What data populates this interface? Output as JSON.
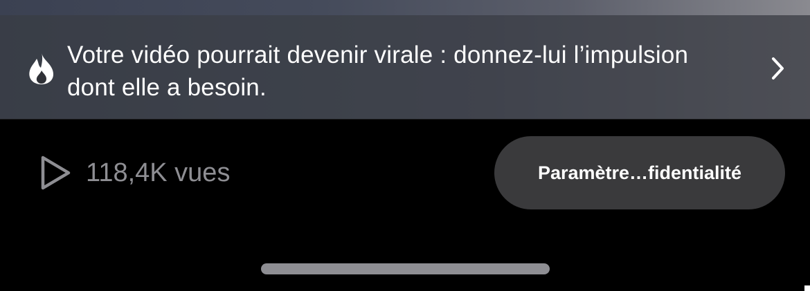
{
  "promo": {
    "text": "Votre vidéo pourrait devenir virale : donnez-lui l’impulsion dont elle a besoin.",
    "icon": "fire-icon",
    "action_icon": "chevron-right-icon"
  },
  "stats": {
    "views_label": "118,4K vues",
    "views_icon": "play-icon"
  },
  "privacy_button": {
    "label": "Paramètre…fidentialité"
  },
  "colors": {
    "background": "#000000",
    "banner_overlay": "#2f3137",
    "button_bg": "#3a3a3c",
    "muted_text": "#8e8e93",
    "text": "#ffffff"
  }
}
